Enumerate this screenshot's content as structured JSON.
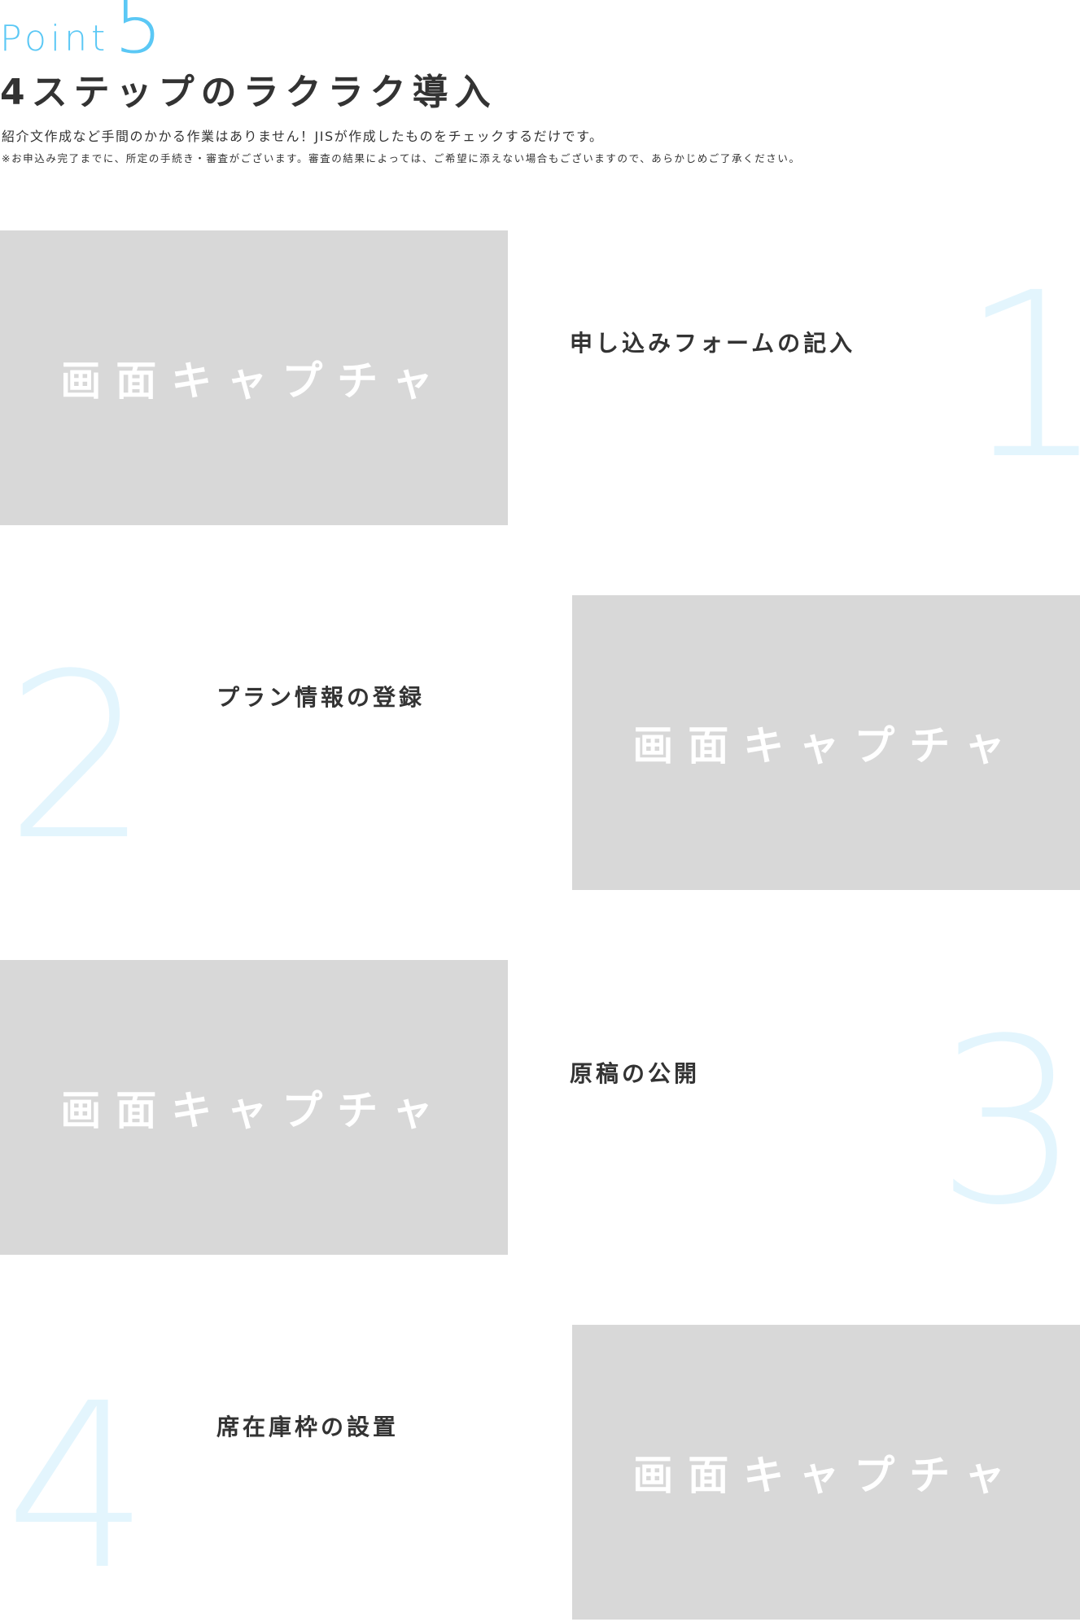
{
  "header": {
    "point_word": "Point",
    "point_number": "5",
    "title": "4ステップのラクラク導入",
    "lead": "紹介文作成など手間のかかる作業はありません！JISが作成したものをチェックするだけです。",
    "note": "※お申込み完了までに、所定の手続き・審査がございます。審査の結果によっては、ご希望に添えない場合もございますので、あらかじめご了承ください。"
  },
  "steps": [
    {
      "number": "1",
      "title": "申し込みフォームの記入",
      "capture_label": "画面キャプチャ"
    },
    {
      "number": "2",
      "title": "プラン情報の登録",
      "capture_label": "画面キャプチャ"
    },
    {
      "number": "3",
      "title": "原稿の公開",
      "capture_label": "画面キャプチャ"
    },
    {
      "number": "4",
      "title": "席在庫枠の設置",
      "capture_label": "画面キャプチャ"
    }
  ],
  "colors": {
    "accent": "#5bc8f5",
    "step_number": "#e3f5fd",
    "placeholder_bg": "#d8d8d8",
    "text": "#333333"
  }
}
